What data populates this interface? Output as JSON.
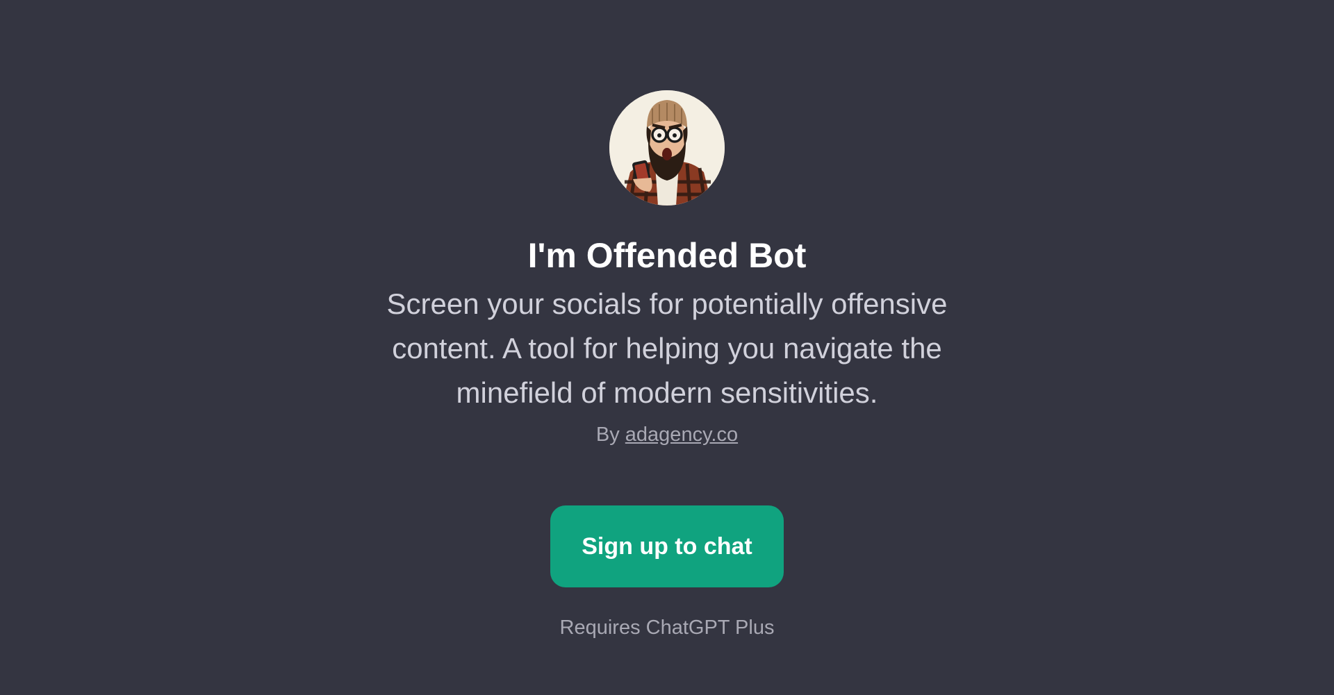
{
  "bot": {
    "avatar_icon": "hipster-offended-avatar-icon",
    "name": "I'm Offended Bot",
    "description": "Screen your socials for potentially offensive content. A tool for helping you navigate the minefield of modern sensitivities.",
    "by_prefix": "By",
    "author": "adagency.co"
  },
  "actions": {
    "signup_label": "Sign up to chat"
  },
  "footer": {
    "requirement": "Requires ChatGPT Plus"
  },
  "colors": {
    "background": "#343541",
    "accent": "#10a37f",
    "title": "#ffffff",
    "description": "#d1d1db",
    "muted": "#a9a9b4"
  }
}
